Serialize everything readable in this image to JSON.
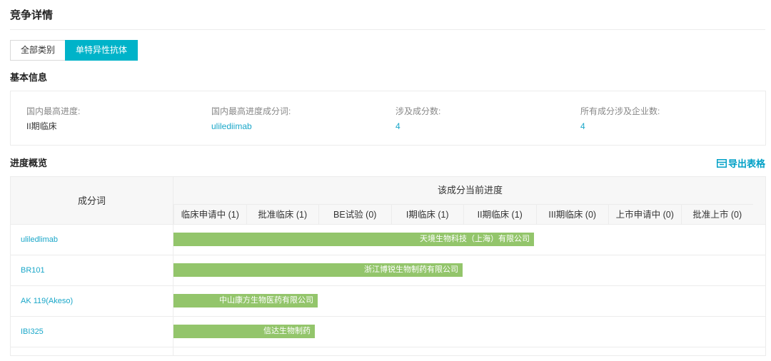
{
  "page": {
    "title": "竞争详情",
    "tabs": [
      {
        "label": "全部类别",
        "active": false
      },
      {
        "label": "单特异性抗体",
        "active": true
      }
    ]
  },
  "basic_info": {
    "title": "基本信息",
    "items": [
      {
        "label": "国内最高进度:",
        "value": "II期临床",
        "link": false
      },
      {
        "label": "国内最高进度成分词:",
        "value": "ulilediimab",
        "link": true
      },
      {
        "label": "涉及成分数:",
        "value": "4",
        "link": true
      },
      {
        "label": "所有成分涉及企业数:",
        "value": "4",
        "link": true
      }
    ]
  },
  "progress": {
    "title": "进度概览",
    "export_label": "导出表格",
    "column_name_header": "成分词",
    "group_header": "该成分当前进度",
    "stages": [
      "临床申请中 (1)",
      "批准临床 (1)",
      "BE试验 (0)",
      "I期临床 (1)",
      "II期临床 (1)",
      "III期临床 (0)",
      "上市申请中 (0)",
      "批准上市 (0)"
    ],
    "rows": [
      {
        "name": "uliledlimab",
        "company": "天境生物科技（上海）有限公司",
        "progress": 0.608
      },
      {
        "name": "BR101",
        "company": "浙江博锐生物制药有限公司",
        "progress": 0.487
      },
      {
        "name": "AK 119(Akeso)",
        "company": "中山康方生物医药有限公司",
        "progress": 0.243
      },
      {
        "name": "IBI325",
        "company": "信达生物制药",
        "progress": 0.238
      }
    ]
  },
  "colors": {
    "accent": "#00b3c9",
    "link": "#1aa7c9",
    "bar": "#93c56b"
  }
}
